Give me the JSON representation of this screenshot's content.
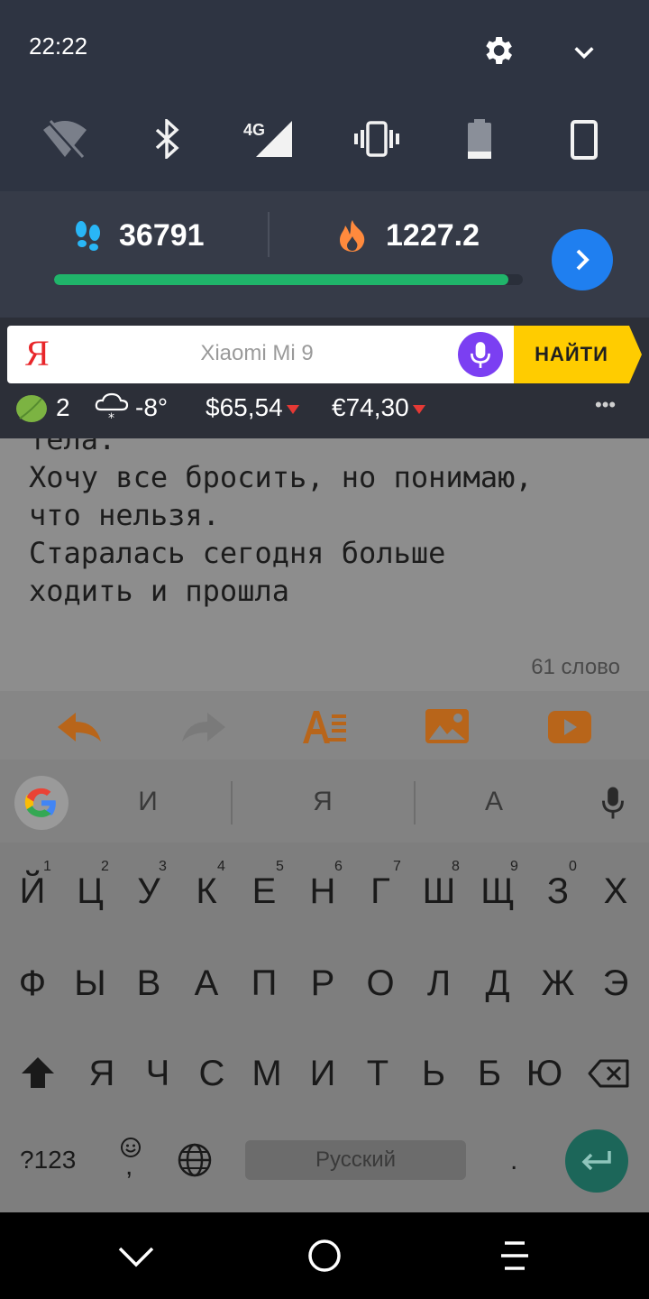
{
  "status_bar": {
    "time": "22:22"
  },
  "fitness": {
    "steps": "36791",
    "calories": "1227.2",
    "progress_fraction": 0.97
  },
  "yandex": {
    "logo": "Я",
    "query": "Xiaomi Mi 9",
    "find_label": "НАЙТИ",
    "badge_count": "2",
    "weather": "-8°",
    "usd": "$65,54",
    "eur": "€74,30",
    "more": "•••"
  },
  "editor": {
    "text": "тела.\nХочу все бросить, но понимаю,\nчто нельзя.\nСтаралась сегодня больше\nходить и прошла",
    "word_count": "61 слово"
  },
  "keyboard": {
    "suggestions": [
      "И",
      "Я",
      "А"
    ],
    "row1": [
      "Й",
      "Ц",
      "У",
      "К",
      "Е",
      "Н",
      "Г",
      "Ш",
      "Щ",
      "З",
      "Х"
    ],
    "row1_hints": [
      "1",
      "2",
      "3",
      "4",
      "5",
      "6",
      "7",
      "8",
      "9",
      "0"
    ],
    "row2": [
      "Ф",
      "Ы",
      "В",
      "А",
      "П",
      "Р",
      "О",
      "Л",
      "Д",
      "Ж",
      "Э"
    ],
    "row3": [
      "Я",
      "Ч",
      "С",
      "М",
      "И",
      "Т",
      "Ь",
      "Б",
      "Ю"
    ],
    "symbols_label": "?123",
    "comma": ",",
    "space_label": "Русский",
    "period": "."
  },
  "colors": {
    "shade": "#2e3442",
    "accent_green": "#20b46a",
    "yandex_yellow": "#ffcc00",
    "toolbar_orange": "#d06a0a"
  }
}
